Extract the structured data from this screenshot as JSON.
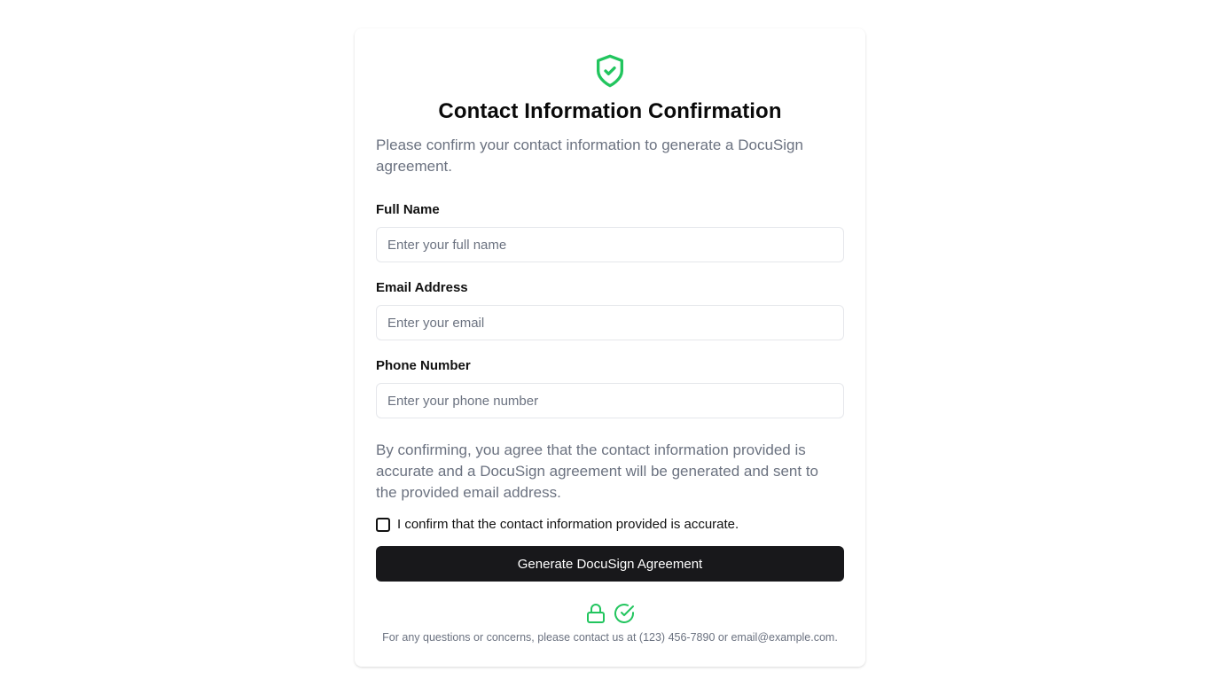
{
  "colors": {
    "accent": "#22c55e",
    "button_bg": "#18181b",
    "muted_text": "#6b7280",
    "border": "#e5e7eb"
  },
  "header": {
    "icon": "shield-check-icon",
    "title": "Contact Information Confirmation",
    "subtitle": "Please confirm your contact information to generate a DocuSign agreement."
  },
  "form": {
    "full_name": {
      "label": "Full Name",
      "placeholder": "Enter your full name",
      "value": ""
    },
    "email": {
      "label": "Email Address",
      "placeholder": "Enter your email",
      "value": ""
    },
    "phone": {
      "label": "Phone Number",
      "placeholder": "Enter your phone number",
      "value": ""
    },
    "disclaimer": "By confirming, you agree that the contact information provided is accurate and a DocuSign agreement will be generated and sent to the provided email address.",
    "confirm_checkbox": {
      "label": "I confirm that the contact information provided is accurate.",
      "checked": false
    },
    "submit_label": "Generate DocuSign Agreement"
  },
  "footer": {
    "icons": [
      "lock-icon",
      "check-circle-icon"
    ],
    "contact_text": "For any questions or concerns, please contact us at (123) 456-7890 or email@example.com."
  }
}
